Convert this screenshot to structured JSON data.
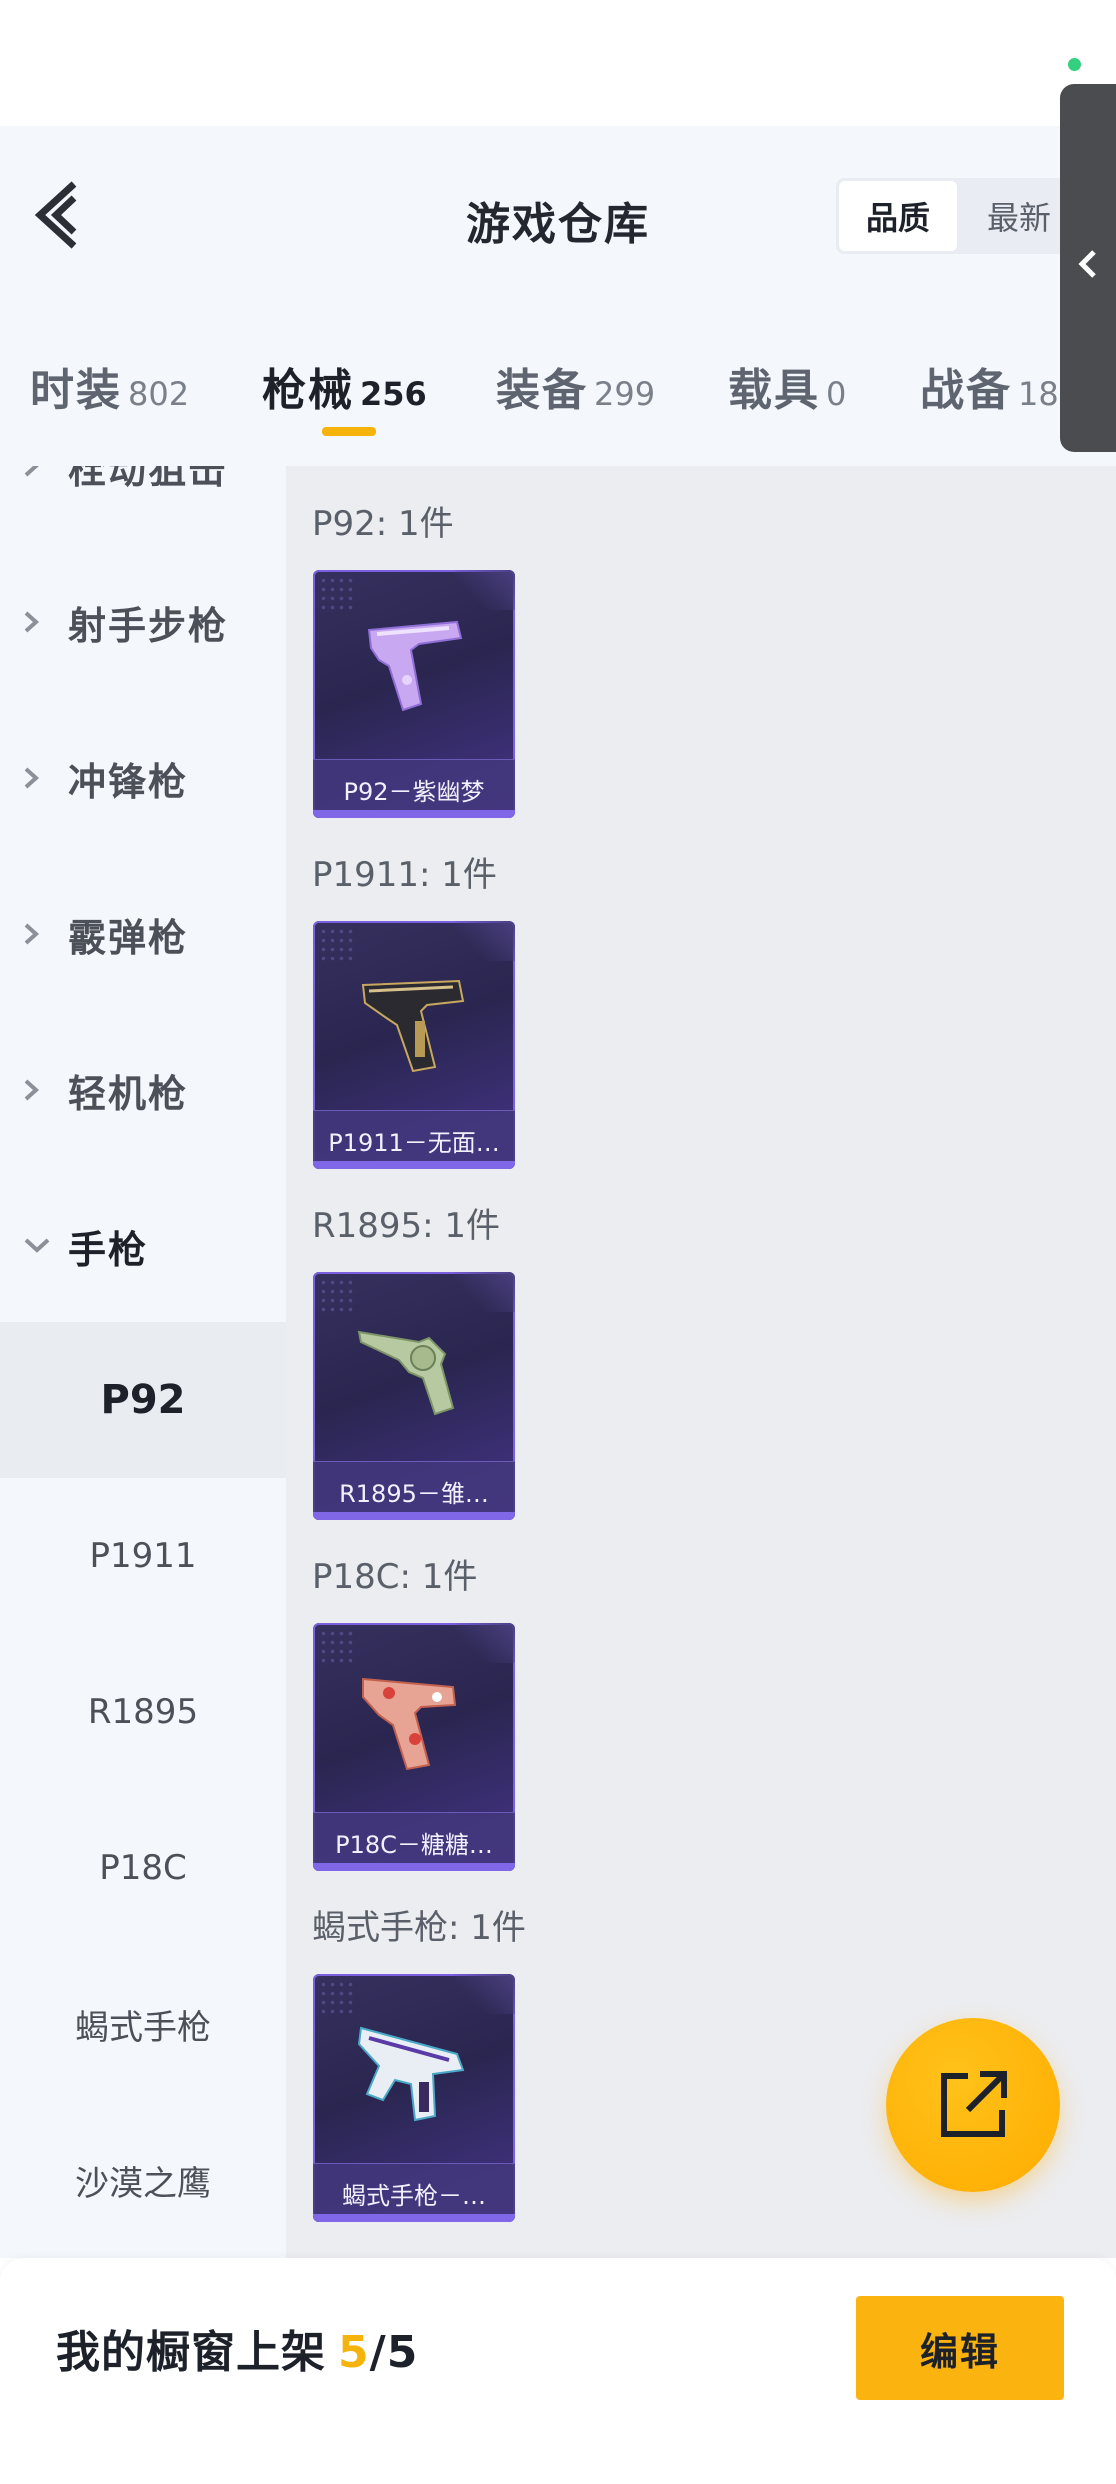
{
  "header": {
    "title": "游戏仓库",
    "sort_options": [
      {
        "label": "品质",
        "active": true
      },
      {
        "label": "最新",
        "active": false
      }
    ]
  },
  "tabs": [
    {
      "name": "时装",
      "count": "802",
      "active": false
    },
    {
      "name": "枪械",
      "count": "256",
      "active": true
    },
    {
      "name": "装备",
      "count": "299",
      "active": false
    },
    {
      "name": "载具",
      "count": "0",
      "active": false
    },
    {
      "name": "战备",
      "count": "18",
      "active": false
    }
  ],
  "sidebar": {
    "categories": [
      {
        "label": "栓动狙击",
        "expanded": false
      },
      {
        "label": "射手步枪",
        "expanded": false
      },
      {
        "label": "冲锋枪",
        "expanded": false
      },
      {
        "label": "霰弹枪",
        "expanded": false
      },
      {
        "label": "轻机枪",
        "expanded": false
      },
      {
        "label": "手枪",
        "expanded": true
      }
    ],
    "subitems": [
      {
        "label": "P92",
        "selected": true
      },
      {
        "label": "P1911",
        "selected": false
      },
      {
        "label": "R1895",
        "selected": false
      },
      {
        "label": "P18C",
        "selected": false
      },
      {
        "label": "蝎式手枪",
        "selected": false
      },
      {
        "label": "沙漠之鹰",
        "selected": false
      }
    ]
  },
  "groups": [
    {
      "label": "P92: 1件",
      "item": "P92－紫幽梦",
      "icon": "pistol-purple-skin"
    },
    {
      "label": "P1911: 1件",
      "item": "P1911－无面…",
      "icon": "pistol-black-gold-skin"
    },
    {
      "label": "R1895: 1件",
      "item": "R1895－雏…",
      "icon": "revolver-green-skin"
    },
    {
      "label": "P18C: 1件",
      "item": "P18C－糖糖…",
      "icon": "pistol-pink-candy-skin"
    },
    {
      "label": "蝎式手枪: 1件",
      "item": "蝎式手枪－…",
      "icon": "smg-pistol-white-skin"
    }
  ],
  "footer": {
    "label": "我的橱窗上架",
    "current": "5",
    "total": "/5",
    "edit_label": "编辑"
  },
  "colors": {
    "accent": "#fbb40f",
    "card_border": "#7a5fe0",
    "status_dot": "#35d07f"
  }
}
